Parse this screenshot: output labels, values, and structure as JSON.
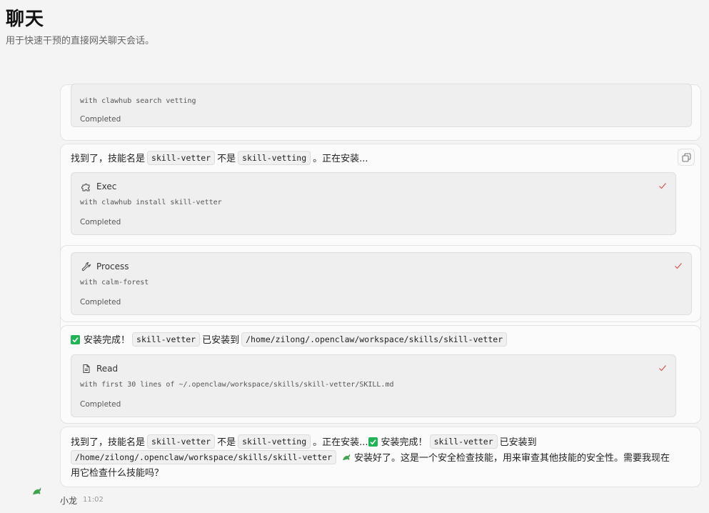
{
  "header": {
    "title": "聊天",
    "subtitle": "用于快速干预的直接网关聊天会话。"
  },
  "messages": [
    {
      "tools": [
        {
          "detail": "with clawhub search vetting",
          "status": "Completed"
        }
      ]
    },
    {
      "text_parts": {
        "a": "找到了，技能名是",
        "code1": "skill-vetter",
        "b": "不是",
        "code2": "skill-vetting",
        "c": "。正在安装..."
      },
      "tools": [
        {
          "icon": "puzzle-icon",
          "name": "Exec",
          "detail": "with clawhub install skill-vetter",
          "status": "Completed"
        }
      ]
    },
    {
      "tools": [
        {
          "icon": "wrench-icon",
          "name": "Process",
          "detail": "with calm-forest",
          "status": "Completed"
        }
      ]
    },
    {
      "text_parts": {
        "a": "安装完成！",
        "code1": "skill-vetter",
        "b": "已安装到",
        "code2": "/home/zilong/.openclaw/workspace/skills/skill-vetter"
      },
      "tools": [
        {
          "icon": "document-icon",
          "name": "Read",
          "detail": "with first 30 lines of ~/.openclaw/workspace/skills/skill-vetter/SKILL.md",
          "status": "Completed"
        }
      ]
    },
    {
      "final": {
        "l1a": "找到了，技能名是",
        "l1code1": "skill-vetter",
        "l1b": "不是",
        "l1code2": "skill-vetting",
        "l1c": "。正在安装...",
        "l1d": "安装完成！",
        "l1code3": "skill-vetter",
        "l1e": "已安装到",
        "l2code": "/home/zilong/.openclaw/workspace/skills/skill-vetter",
        "l2a": "安装好了。这是一个安全检查技能，用来审查其他技能的安全性。需要我现在",
        "l3": "用它检查什么技能吗？"
      }
    }
  ],
  "footer": {
    "sender": "小龙",
    "time": "11:02"
  },
  "colors": {
    "check_green": "#22b357",
    "tick_red": "#d9534f"
  }
}
